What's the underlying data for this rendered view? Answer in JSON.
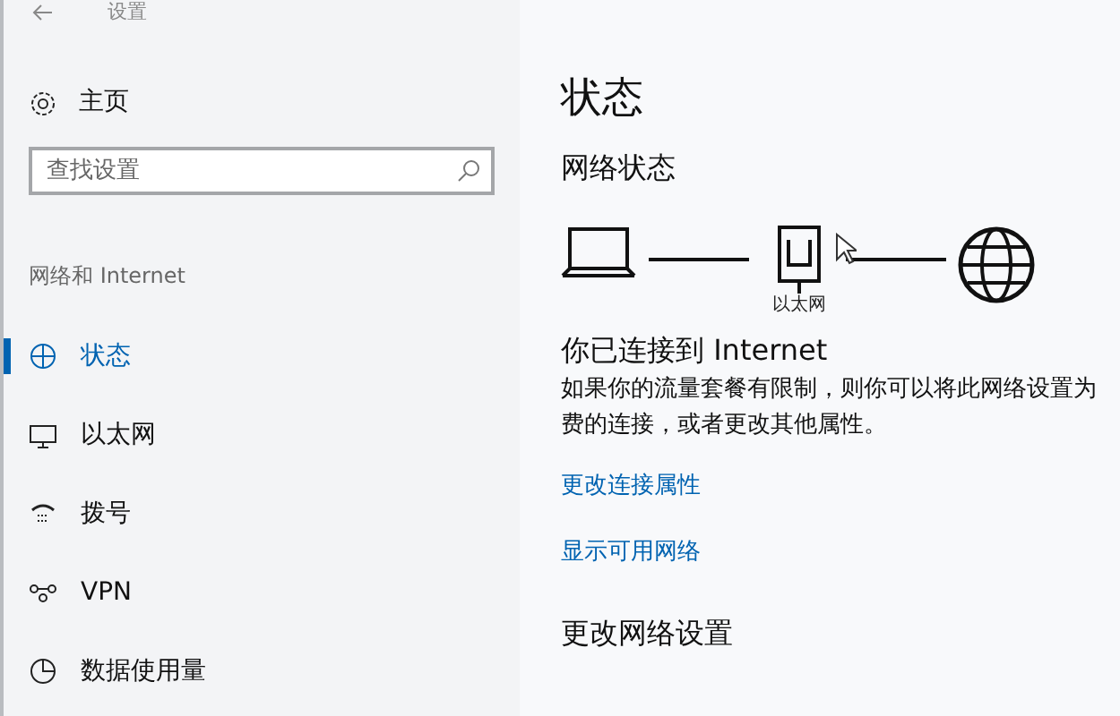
{
  "window": {
    "title": "设置"
  },
  "sidebar": {
    "home": "主页",
    "search": {
      "placeholder": "查找设置"
    },
    "group": "网络和 Internet",
    "items": [
      {
        "label": "状态",
        "selected": true
      },
      {
        "label": "以太网",
        "selected": false
      },
      {
        "label": "拨号",
        "selected": false
      },
      {
        "label": "VPN",
        "selected": false
      },
      {
        "label": "数据使用量",
        "selected": false
      }
    ]
  },
  "content": {
    "title": "状态",
    "section": "网络状态",
    "diagram_label": "以太网",
    "connected": "你已连接到 Internet",
    "description_lines": [
      "如果你的流量套餐有限制，则你可以将此网络设置为",
      "费的连接，或者更改其他属性。"
    ],
    "links": [
      "更改连接属性",
      "显示可用网络"
    ],
    "section2": "更改网络设置"
  }
}
